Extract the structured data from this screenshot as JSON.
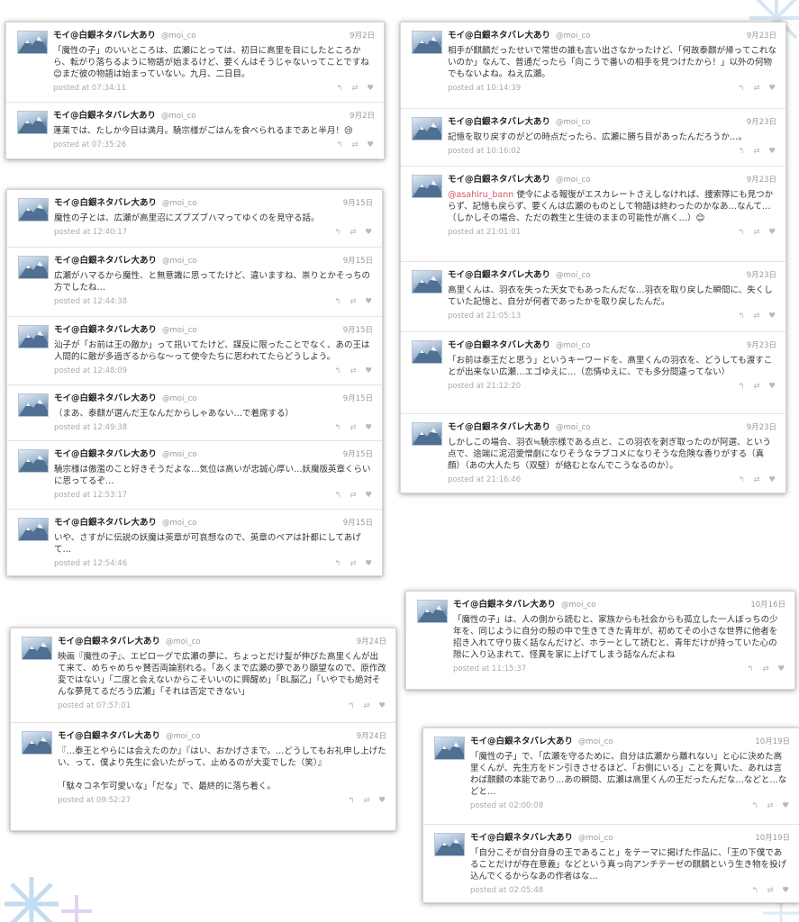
{
  "accent_mention_color": "#d9546a",
  "icons": [
    "reply-icon",
    "retweet-icon",
    "favorite-icon",
    "avatar-image"
  ],
  "user": {
    "name": "モイ@白銀ネタバレ大あり",
    "handle": "@moi_co"
  },
  "cards": [
    {
      "tweets": [
        {
          "date": "9月2日",
          "text": "「魔性の子」のいいところは、広瀬にとっては、初日に高里を目にしたところから、転がり落ちるように物語が始まるけど、要くんはそうじゃないってことですね😊まだ彼の物語は始まっていない。九月、二日目。",
          "posted": "posted at 07:34:11"
        },
        {
          "date": "9月2日",
          "text": "蓬莱では、たしか今日は満月。驍宗様がごはんを食べられるまであと半月！😢",
          "posted": "posted at 07:35:26"
        }
      ]
    },
    {
      "tweets": [
        {
          "date": "9月15日",
          "text": "魔性の子とは、広瀬が高里沼にズブズブハマってゆくのを見守る話。",
          "posted": "posted at 12:40:17"
        },
        {
          "date": "9月15日",
          "text": "広瀬がハマるから魔性、と無意識に思ってたけど、違いますね、祟りとかそっちの方でしたね…",
          "posted": "posted at 12:44:38"
        },
        {
          "date": "9月15日",
          "text": "汕子が「お前は王の敵か」って訊いてたけど、謀反に限ったことでなく、あの王は人間的に敵が多過ぎるからな〜って使令たちに思われてたらどうしよう。",
          "posted": "posted at 12:48:09"
        },
        {
          "date": "9月15日",
          "text": "（まあ、泰麒が選んだ王なんだからしゃあない…で着席する）",
          "posted": "posted at 12:49:38"
        },
        {
          "date": "9月15日",
          "text": "驍宗様は傲濫のこと好きそうだよな…気位は高いが忠誠心厚い…妖魔版英章くらいに思ってるぞ…",
          "posted": "posted at 12:53:17"
        },
        {
          "date": "9月15日",
          "text": "いや、さすがに伝説の妖魔は英章が可哀想なので、英章のペアは計都にしてあげて…",
          "posted": "posted at 12:54:46"
        }
      ]
    },
    {
      "tweets": [
        {
          "date": "9月24日",
          "text": "映画『魔性の子』、エピローグで広瀬の夢に、ちょっとだけ髪が伸びた高里くんが出て来て、めちゃめちゃ賛否両論割れる。「あくまで広瀬の夢であり願望なので、原作改変ではない」「二度と会えないからこそいいのに興醒め」「BL脳乙」「いやでも絶対そんな夢見てるだろう広瀬」「それは否定できない」",
          "posted": "posted at 07:57:01"
        },
        {
          "date": "9月24日",
          "text": "『…泰王とやらには会えたのか』『はい、おかげさまで。…どうしてもお礼申し上げたい、って、僕より先生に会いたがって、止めるのが大変でした（笑）』\n\n「駄々コネ乍可愛いな」「だな」で、最終的に落ち着く。",
          "posted": "posted at 09:52:27"
        }
      ]
    },
    {
      "tweets": [
        {
          "date": "9月23日",
          "text": "相手が麒麟だったせいで常世の誰も言い出さなかったけど、「何故泰麒が帰ってこれないのか」なんて、普通だったら「向こうで番いの相手を見つけたから！」以外の何物でもないよね。ねえ広瀬。",
          "posted": "posted at 10:14:39"
        },
        {
          "date": "9月23日",
          "text": "記憶を取り戻すのがどの時点だったら、広瀬に勝ち目があったんだろうか…。",
          "posted": "posted at 10:16:02"
        },
        {
          "date": "9月23日",
          "mention": "@asahiru_bann",
          "text": " 使令による報復がエスカレートさえしなければ、捜索隊にも見つからず、記憶も戻らず、要くんは広瀬のものとして物語は終わったのかなあ…なんて…（しかしその場合、ただの教生と生徒のままの可能性が高く…）😊",
          "posted": "posted at 21:01:01"
        },
        {
          "date": "9月23日",
          "text": "高里くんは、羽衣を失った天女でもあったんだな…羽衣を取り戻した瞬間に、失くしていた記憶と、自分が何者であったかを取り戻したんだ。",
          "posted": "posted at 21:05:13"
        },
        {
          "date": "9月23日",
          "text": "「お前は泰王だと思う」というキーワードを、高里くんの羽衣を、どうしても渡すことが出来ない広瀬…エゴゆえに…（恋情ゆえに、でも多分間違ってない）",
          "posted": "posted at 21:12:20"
        },
        {
          "date": "9月23日",
          "text": "しかしこの場合、羽衣≒驍宗様である点と、この羽衣を剥ぎ取ったのが阿選、という点で、途端に泥沼愛憎劇になりそうなラブコメになりそうな危険な香りがする（真顔）（あの大人たち（双璧）が絡むとなんでこうなるのか）。",
          "posted": "posted at 21:16:46"
        }
      ]
    },
    {
      "tweets": [
        {
          "date": "10月16日",
          "text": "「魔性の子」は、人の側から読むと、家族からも社会からも孤立した一人ぼっちの少年を、同じように自分の殻の中で生きてきた青年が、初めてその小さな世界に他者を招き入れて守り抜く話なんだけど、ホラーとして読むと、青年だけが持っていた心の隙に入り込まれて、怪異を家に上げてしまう話なんだよね",
          "posted": "posted at 11:15:37"
        }
      ]
    },
    {
      "tweets": [
        {
          "date": "10月19日",
          "text": "「魔性の子」で、「広瀬を守るために、自分は広瀬から離れない」と心に決めた高里くんが、先生方をドン引きさせるほど、「お側にいる」ことを貫いた、あれは言わば麒麟の本能であり…あの瞬間、広瀬は高里くんの王だったんだな…などと…などと…",
          "posted": "posted at 02:00:08"
        },
        {
          "date": "10月19日",
          "text": "「自分こそが自分自身の王であること」をテーマに掲げた作品に、「王の下僕であることだけが存在意義」などという真っ向アンチテーゼの麒麟という生き物を投げ込んでくるからなあの作者はな…",
          "posted": "posted at 02:05:48"
        }
      ]
    }
  ]
}
